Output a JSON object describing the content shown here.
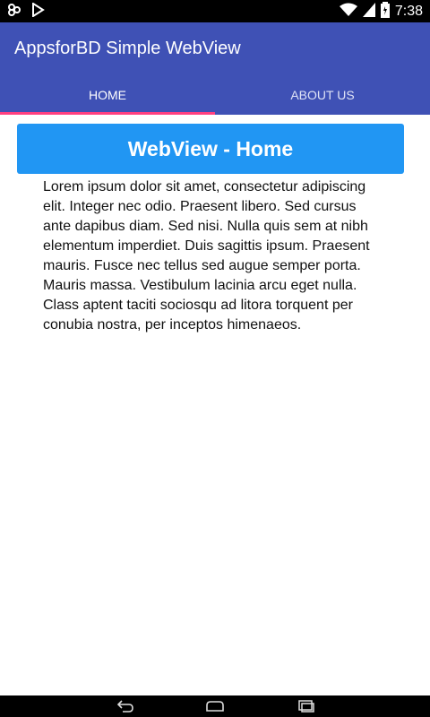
{
  "status_bar": {
    "time": "7:38",
    "icons": [
      "notification-icon",
      "play-store-icon",
      "wifi-icon",
      "signal-icon",
      "battery-icon"
    ]
  },
  "app": {
    "title": "AppsforBD Simple WebView",
    "tabs": [
      {
        "label": "HOME",
        "selected": true
      },
      {
        "label": "ABOUT US",
        "selected": false
      }
    ],
    "colors": {
      "primary": "#3f51b5",
      "accent": "#ff4081",
      "header": "#2196f3"
    }
  },
  "web": {
    "heading": "WebView - Home",
    "body": "Lorem ipsum dolor sit amet, consectetur adipiscing elit. Integer nec odio. Praesent libero. Sed cursus ante dapibus diam. Sed nisi. Nulla quis sem at nibh elementum imperdiet. Duis sagittis ipsum. Praesent mauris. Fusce nec tellus sed augue semper porta. Mauris massa. Vestibulum lacinia arcu eget nulla. Class aptent taciti sociosqu ad litora torquent per conubia nostra, per inceptos himenaeos."
  },
  "nav_bar": {
    "buttons": [
      "back-icon",
      "home-icon",
      "recents-icon"
    ]
  }
}
